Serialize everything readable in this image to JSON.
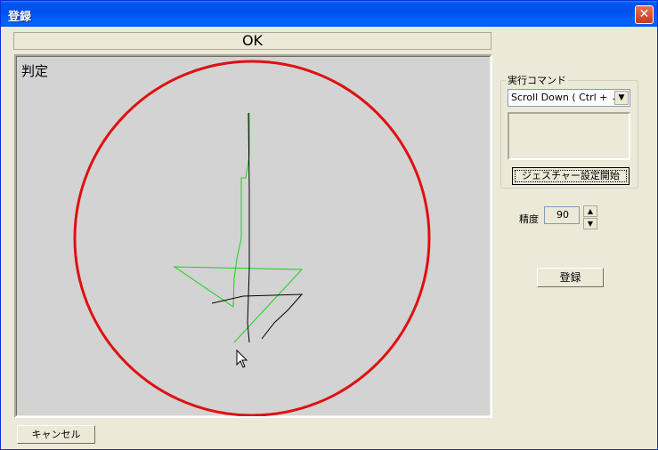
{
  "window": {
    "title": "登録",
    "close_glyph": "✕"
  },
  "status": {
    "text": "OK"
  },
  "canvas": {
    "label": "判定"
  },
  "command_group": {
    "legend": "実行コマンド",
    "selected_command": "Scroll Down ( Ctrl + ↓ )",
    "gesture_button": "ジェスチャー設定開始"
  },
  "precision": {
    "label": "精度",
    "value": "90"
  },
  "buttons": {
    "register": "登録",
    "cancel": "キャンセル"
  },
  "colors": {
    "circle": "#e01010",
    "template_stroke": "#19d219",
    "user_stroke": "#000000",
    "titlebar": "#0054e3"
  }
}
